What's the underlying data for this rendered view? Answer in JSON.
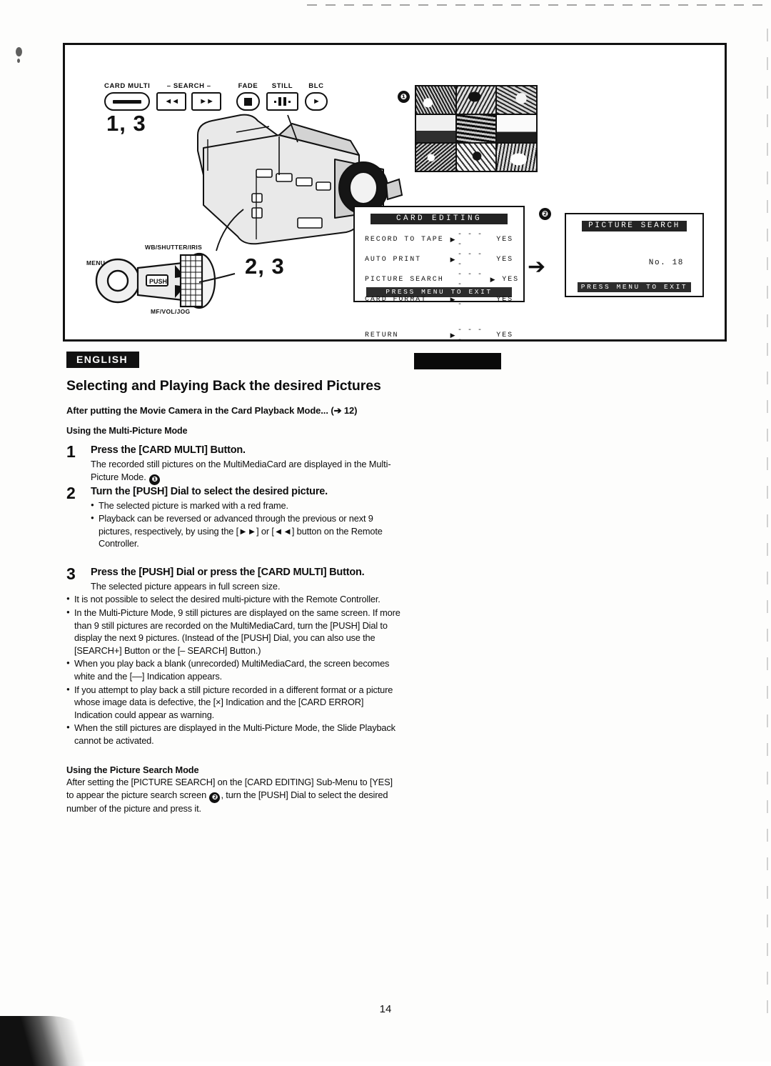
{
  "page": {
    "number": "14",
    "language_tag": "ENGLISH"
  },
  "illustration": {
    "buttons": [
      {
        "caption": "CARD MULTI",
        "icon": "dash-button-icon"
      },
      {
        "caption": "◄◄",
        "icon": "rewind-search-icon"
      },
      {
        "caption": "►►",
        "icon": "forward-search-icon"
      },
      {
        "caption": "FADE",
        "icon": "fade-square-icon"
      },
      {
        "caption": "STILL",
        "icon": "still-pause-icon"
      },
      {
        "caption": "BLC",
        "icon": "blc-play-icon"
      }
    ],
    "search_group_caption": "– SEARCH –",
    "callouts": {
      "buttons_callout": "1, 3",
      "dial_callout": "2, 3"
    },
    "dial_labels": {
      "menu": "MENU",
      "top": "WB/SHUTTER/IRIS",
      "bottom": "MF/VOL/JOG",
      "push": "PUSH"
    },
    "markers": {
      "multi_picture": "❶",
      "picture_search": "❷"
    }
  },
  "osd_card_editing": {
    "title": "CARD EDITING",
    "rows": [
      {
        "item": "RECORD TO TAPE",
        "cursor": "▶",
        "dashes": "- - - -",
        "value": "YES",
        "cursor_right": ""
      },
      {
        "item": "AUTO PRINT",
        "cursor": "▶",
        "dashes": "- - - -",
        "value": "YES",
        "cursor_right": ""
      },
      {
        "item": "PICTURE SEARCH",
        "cursor": "",
        "dashes": "- - - -",
        "value": "YES",
        "cursor_right": "▶"
      },
      {
        "item": "CARD FORMAT",
        "cursor": "▶",
        "dashes": "- - - -",
        "value": "YES",
        "cursor_right": ""
      }
    ],
    "return_row": {
      "item": "RETURN",
      "cursor": "▶",
      "dashes": "- - - -",
      "value": "YES"
    },
    "footer": "PRESS MENU TO EXIT"
  },
  "osd_picture_search": {
    "title": "PICTURE SEARCH",
    "number_label": "No. 18",
    "footer": "PRESS MENU TO EXIT"
  },
  "article": {
    "title": "Selecting and Playing Back the desired Pictures",
    "lead": "After putting the Movie Camera in the Card Playback Mode... (➔ 12)",
    "subhead": "Using the Multi-Picture Mode",
    "steps": [
      {
        "num": "1",
        "head": "Press the [CARD MULTI] Button.",
        "desc_a": "The recorded still pictures on the MultiMediaCard are displayed in the Multi-Picture Mode.",
        "desc_marker": "❶",
        "bullets": []
      },
      {
        "num": "2",
        "head": "Turn the [PUSH] Dial to select the desired picture.",
        "desc_a": "",
        "bullets": [
          "The selected picture is marked with a red frame.",
          "Playback can be reversed or advanced through the previous or next 9 pictures, respectively, by using the [►►] or [◄◄] button on the Remote Controller."
        ]
      },
      {
        "num": "3",
        "head": "Press the [PUSH] Dial or press the [CARD MULTI] Button.",
        "desc_a": "The selected picture appears in full screen size.",
        "bullets": []
      }
    ],
    "notes": [
      "It is not possible to select the desired multi-picture with the Remote Controller.",
      "In the Multi-Picture Mode, 9 still pictures are displayed on the same screen. If more than 9 still pictures are recorded on the MultiMediaCard, turn the [PUSH] Dial to display the next 9 pictures. (Instead of  the [PUSH] Dial, you can also use the [SEARCH+] Button or the [– SEARCH] Button.)",
      "When you play back a blank (unrecorded) MultiMediaCard, the screen becomes white and the [––] Indication appears.",
      "If you attempt to play back a still picture recorded in a different format or a picture whose image data is defective, the [×] Indication and the [CARD ERROR] Indication could appear as warning.",
      "When the still pictures are displayed in the Multi-Picture Mode, the Slide Playback cannot be activated."
    ],
    "tail_head": "Using the Picture Search Mode",
    "tail_body_a": "After setting the [PICTURE SEARCH] on the [CARD EDITING] Sub-Menu to [YES] to appear the picture search screen ",
    "tail_marker": "❷",
    "tail_body_b": ", turn the [PUSH] Dial to select the desired number of the picture and press it."
  }
}
